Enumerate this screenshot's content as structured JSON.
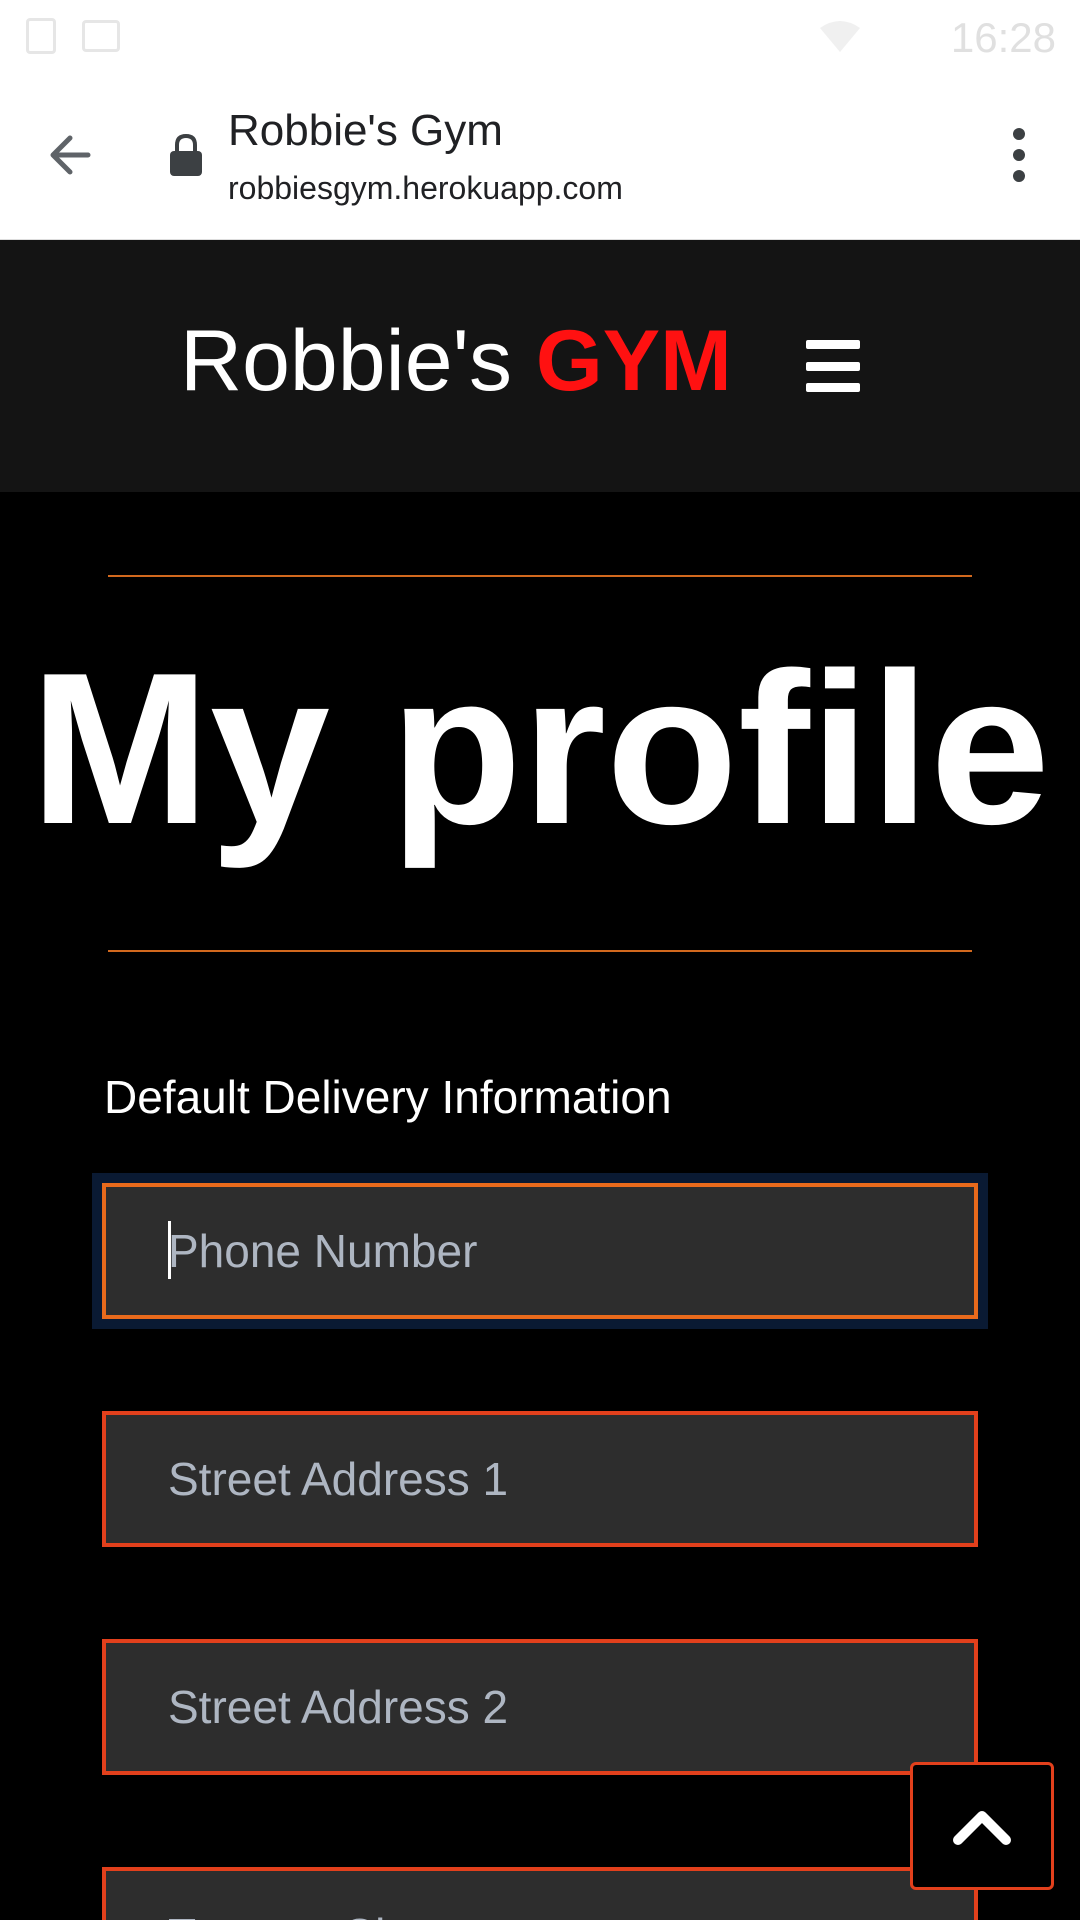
{
  "status_bar": {
    "time": "16:28",
    "icons": [
      "sim-icon",
      "image-icon",
      "wifi-icon"
    ]
  },
  "browser": {
    "page_title": "Robbie's Gym",
    "url": "robbiesgym.herokuapp.com",
    "icons": [
      "back-arrow-icon",
      "lock-icon",
      "more-vert-icon"
    ]
  },
  "nav": {
    "brand_prefix": "Robbie's",
    "brand_accent": "GYM",
    "menu_icon": "hamburger-icon"
  },
  "main": {
    "heading": "My profile",
    "section_label": "Default Delivery Information",
    "fields": [
      {
        "placeholder": "Phone Number",
        "value": ""
      },
      {
        "placeholder": "Street Address 1",
        "value": ""
      },
      {
        "placeholder": "Street Address 2",
        "value": ""
      },
      {
        "placeholder": "Town or City",
        "value": ""
      }
    ],
    "back_to_top_icon": "chevron-up-icon"
  },
  "colors": {
    "nav_bg": "#141414",
    "brand_accent": "#ff1111",
    "divider": "#d2691e",
    "field_border": "#e2401c",
    "field_border_focused": "#e86a1c",
    "field_bg": "#2d2d2d"
  }
}
